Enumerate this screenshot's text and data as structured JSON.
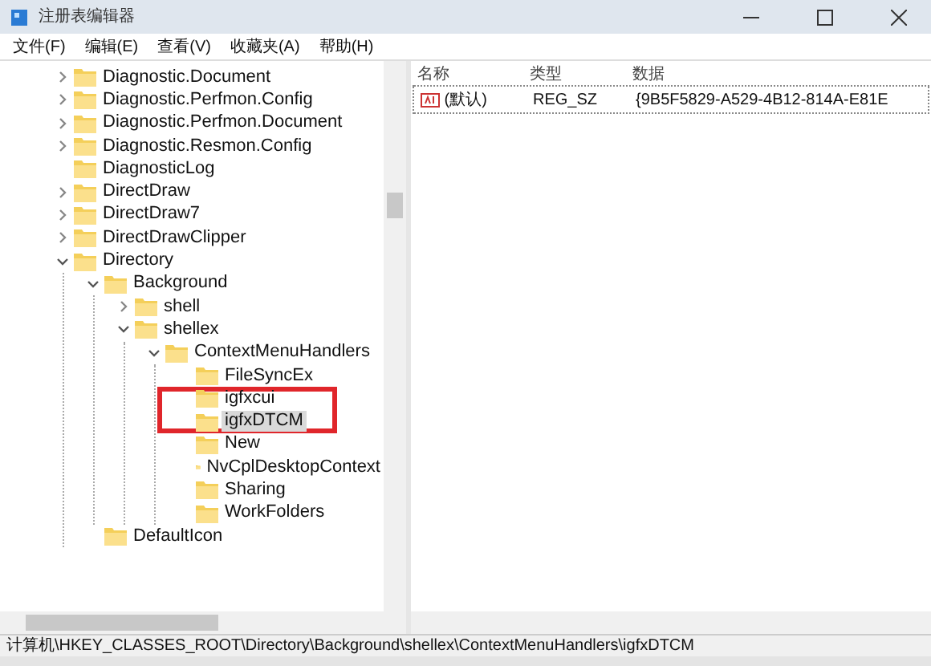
{
  "window": {
    "title": "注册表编辑器"
  },
  "menu": [
    "文件(F)",
    "编辑(E)",
    "查看(V)",
    "收藏夹(A)",
    "帮助(H)"
  ],
  "tree": [
    {
      "label": "Diagnostic.Document",
      "has_children": true,
      "expanded": false,
      "selected": false,
      "highlighted": false
    },
    {
      "label": "Diagnostic.Perfmon.Config",
      "has_children": true,
      "expanded": false,
      "selected": false,
      "highlighted": false
    },
    {
      "label": "Diagnostic.Perfmon.Document",
      "has_children": true,
      "expanded": false,
      "selected": false,
      "highlighted": false
    },
    {
      "label": "Diagnostic.Resmon.Config",
      "has_children": true,
      "expanded": false,
      "selected": false,
      "highlighted": false
    },
    {
      "label": "DiagnosticLog",
      "has_children": false,
      "selected": false,
      "highlighted": false
    },
    {
      "label": "DirectDraw",
      "has_children": true,
      "expanded": false,
      "selected": false,
      "highlighted": false
    },
    {
      "label": "DirectDraw7",
      "has_children": true,
      "expanded": false,
      "selected": false,
      "highlighted": false
    },
    {
      "label": "DirectDrawClipper",
      "has_children": true,
      "expanded": false,
      "selected": false,
      "highlighted": false
    },
    {
      "label": "Directory",
      "has_children": true,
      "expanded": true,
      "selected": false,
      "highlighted": false,
      "children": [
        {
          "label": "Background",
          "has_children": true,
          "expanded": true,
          "selected": false,
          "highlighted": false,
          "children": [
            {
              "label": "shell",
              "has_children": true,
              "expanded": false,
              "selected": false,
              "highlighted": false
            },
            {
              "label": "shellex",
              "has_children": true,
              "expanded": true,
              "selected": false,
              "highlighted": false,
              "children": [
                {
                  "label": "ContextMenuHandlers",
                  "has_children": true,
                  "expanded": true,
                  "selected": false,
                  "highlighted": false,
                  "children": [
                    {
                      "label": "FileSyncEx",
                      "has_children": false,
                      "selected": false,
                      "highlighted": false
                    },
                    {
                      "label": "igfxcui",
                      "has_children": false,
                      "selected": false,
                      "highlighted": true
                    },
                    {
                      "label": "igfxDTCM",
                      "has_children": false,
                      "selected": true,
                      "highlighted": true
                    },
                    {
                      "label": "New",
                      "has_children": false,
                      "selected": false,
                      "highlighted": false
                    },
                    {
                      "label": "NvCplDesktopContext",
                      "has_children": false,
                      "selected": false,
                      "highlighted": false
                    },
                    {
                      "label": "Sharing",
                      "has_children": false,
                      "selected": false,
                      "highlighted": false
                    },
                    {
                      "label": "WorkFolders",
                      "has_children": false,
                      "selected": false,
                      "highlighted": false
                    }
                  ]
                }
              ]
            }
          ]
        },
        {
          "label": "DefaultIcon",
          "has_children": false,
          "selected": false,
          "highlighted": false
        }
      ]
    }
  ],
  "values": {
    "columns": [
      "名称",
      "类型",
      "数据"
    ],
    "rows": [
      {
        "name": "(默认)",
        "type": "REG_SZ",
        "data": "{9B5F5829-A529-4B12-814A-E81E"
      }
    ]
  },
  "status_bar": "计算机\\HKEY_CLASSES_ROOT\\Directory\\Background\\shellex\\ContextMenuHandlers\\igfxDTCM"
}
